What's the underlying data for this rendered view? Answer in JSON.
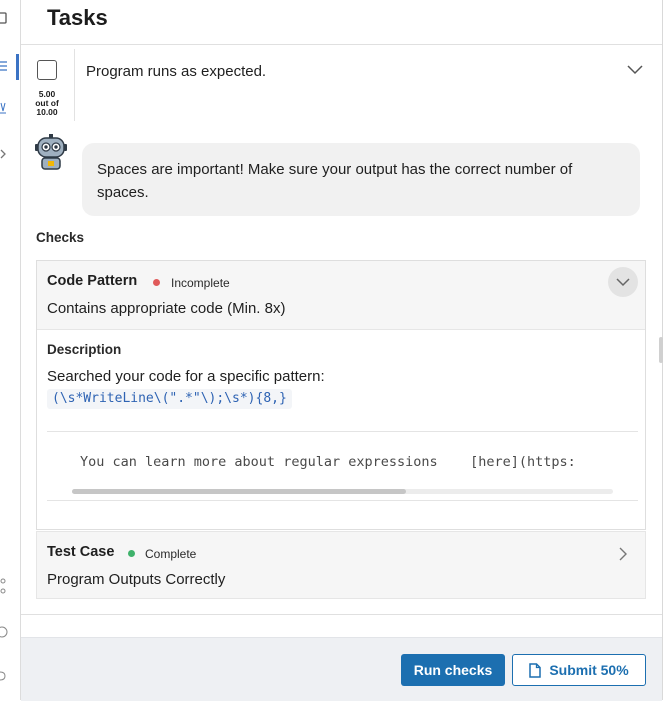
{
  "header": {
    "title": "Tasks"
  },
  "task": {
    "label": "Program runs as expected.",
    "score": {
      "value": "5.00",
      "out_of_label": "out of",
      "max": "10.00"
    }
  },
  "hint": {
    "text": "Spaces are important! Make sure your output has the correct number of spaces."
  },
  "checks": {
    "label": "Checks",
    "items": [
      {
        "title": "Code Pattern",
        "status": "Incomplete",
        "status_color": "#e05a5a",
        "subtitle": "Contains appropriate code (Min. 8x)",
        "description_label": "Description",
        "description_text": "Searched your code for a specific pattern:",
        "pattern": "(\\s*WriteLine\\(\".*\"\\);\\s*){8,}",
        "code_line": "You can learn more about regular expressions    [here](https:"
      },
      {
        "title": "Test Case",
        "status": "Complete",
        "status_color": "#3fb26b",
        "subtitle": "Program Outputs Correctly"
      }
    ]
  },
  "footer": {
    "run_label": "Run checks",
    "submit_label": "Submit 50%"
  },
  "colors": {
    "accent": "#1c6fb0",
    "rail_active": "#3b73c4"
  }
}
